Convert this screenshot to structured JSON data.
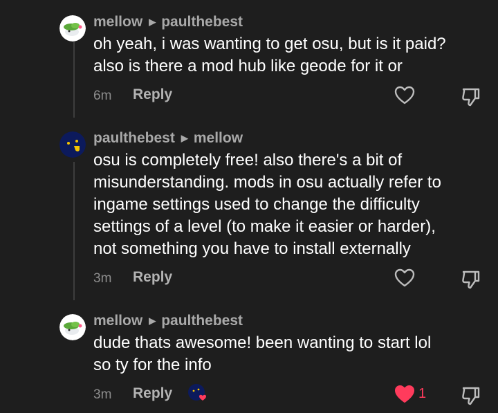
{
  "comments": [
    {
      "author": "mellow",
      "reply_to": "paulthebest",
      "text_lines": [
        "oh yeah, i was wanting to get osu, but is it paid?",
        "also is there a mod hub like geode for it or"
      ],
      "time": "6m",
      "reply_label": "Reply",
      "avatar": "shaymin-avatar-icon",
      "liked": false
    },
    {
      "author": "paulthebest",
      "reply_to": "mellow",
      "text_lines": [
        "osu is completely free! also there's a bit of",
        "misunderstanding. mods in osu actually refer to",
        "ingame settings used to change the difficulty",
        "settings of a level (to make it easier or harder),",
        "not something you have to install externally"
      ],
      "time": "3m",
      "reply_label": "Reply",
      "avatar": "tongue-face-avatar-icon",
      "liked": false
    },
    {
      "author": "mellow",
      "reply_to": "paulthebest",
      "text_lines": [
        "dude thats awesome! been wanting to start lol",
        "so ty for the info"
      ],
      "time": "3m",
      "reply_label": "Reply",
      "avatar": "shaymin-avatar-icon",
      "liked": true,
      "like_count": "1",
      "liked_by_author": "creator-liked-avatar-icon"
    }
  ],
  "colors": {
    "background": "#1e1e1e",
    "username": "#a9a9a9",
    "like_active": "#ff3b5c"
  }
}
